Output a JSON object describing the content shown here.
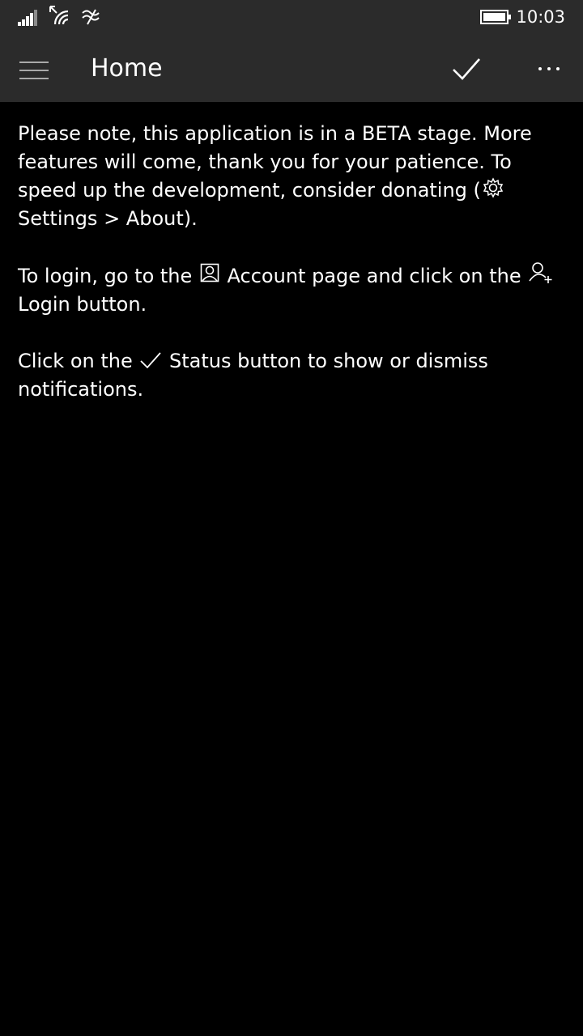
{
  "status_bar": {
    "time": "10:03",
    "icons": [
      "signal-bars-icon",
      "wifi-icon",
      "data-transfer-icon",
      "battery-icon"
    ]
  },
  "app_bar": {
    "menu_icon": "hamburger-icon",
    "title": "Home",
    "actions": [
      "check-icon",
      "more-icon"
    ]
  },
  "content": {
    "para1": {
      "text": "Please note, this application is in a BETA stage. More features will come, thank you for your patience. To speed up the development, consider donating (",
      "icon": "gear-icon",
      "text_after": " Settings > About)."
    },
    "para2": {
      "text_before": "To login, go to the ",
      "icon1": "account-icon",
      "text_middle": " Account page and click on the ",
      "icon2": "add-person-icon",
      "text_after": " Login button."
    },
    "para3": {
      "text_before": "Click on the ",
      "icon": "check-icon",
      "text_after": " Status button to show or dismiss notifications."
    }
  },
  "colors": {
    "background": "#000000",
    "bar_background": "#2b2b2b",
    "text": "#ffffff"
  }
}
